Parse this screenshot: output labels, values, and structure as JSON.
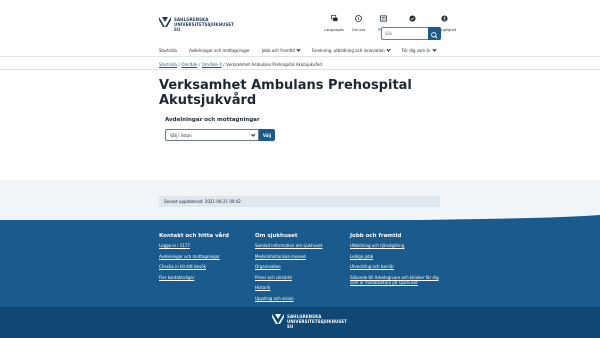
{
  "header": {
    "logo_lines": [
      "SAHLGRENSKA",
      "UNIVERSITETSSJUKHUSET",
      "SU"
    ],
    "tools": [
      {
        "label": "Languages",
        "icon": "language-icon"
      },
      {
        "label": "Om oss",
        "icon": "info-icon"
      },
      {
        "label": "Press",
        "icon": "newspaper-icon"
      },
      {
        "label": "Arbetsplatsen",
        "icon": "checkmark-icon"
      },
      {
        "label": "Tillgänglighet",
        "icon": "accessibility-icon"
      }
    ],
    "search": {
      "placeholder": "Sök"
    }
  },
  "nav": {
    "items": [
      {
        "label": "Startsida",
        "has_dropdown": false
      },
      {
        "label": "Avdelningar och mottagningar",
        "has_dropdown": false
      },
      {
        "label": "Jobb och framtid",
        "has_dropdown": true
      },
      {
        "label": "Forskning, utbildning och innovation",
        "has_dropdown": true
      },
      {
        "label": "För dig som är",
        "has_dropdown": true
      }
    ]
  },
  "breadcrumb": {
    "items": [
      "Startsida",
      "Område",
      "Område 4"
    ],
    "current": "Verksamhet Ambulans Prehospital Akutsjukvård"
  },
  "page": {
    "title": "Verksamhet Ambulans Prehospital Akutsjukvård",
    "section_title": "Avdelningar och mottagningar",
    "select_value": "Välj i listan",
    "choose_label": "Välj",
    "updated": "Senast uppdaterad: 2021-06-21 00:42"
  },
  "footer": {
    "columns": [
      {
        "title": "Kontakt och hitta vård",
        "links": [
          "Logga in i 1177",
          "Avdelningar och mottagningar",
          "Checka in till ditt besök",
          "Fler kontaktvägar"
        ]
      },
      {
        "title": "Om sjukhuset",
        "links": [
          "Samlad information om sjukhuset",
          "Medicinhistoriska museet",
          "Organisation",
          "Priser och utmärkt",
          "Historik",
          "Uppdrag och vision"
        ]
      },
      {
        "title": "Jobb och framtid",
        "links": [
          "Utbildning och tjänstgöring",
          "Lediga jobb",
          "Utveckling och karriär",
          "Sökande till Arbetsgivare och kliniker för dig som är medarbetare på sjukhuset"
        ]
      }
    ],
    "logo_lines": [
      "SAHLGRENSKA",
      "UNIVERSITETSSJUKHUSET",
      "SU"
    ]
  },
  "colors": {
    "primary": "#1a5a8c",
    "footer": "#1a5a8c",
    "footer_bottom": "#0f4775",
    "band": "#f1f5f8"
  }
}
